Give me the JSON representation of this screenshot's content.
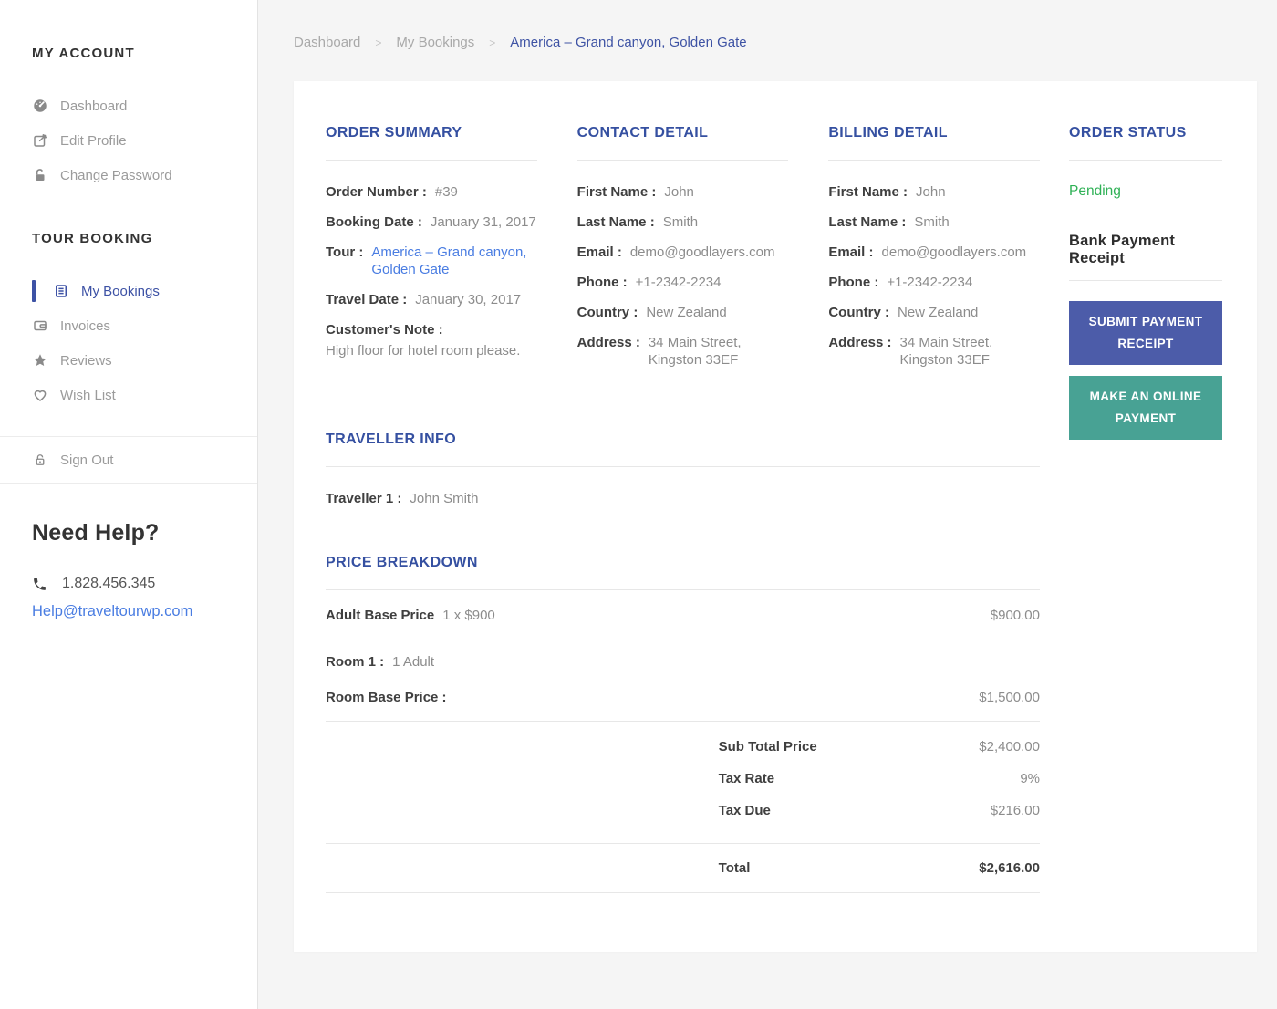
{
  "colors": {
    "accent_indigo": "#3550a1",
    "link_blue": "#4a7de2",
    "status_green": "#2fb156",
    "button_indigo": "#4c5ca9",
    "button_teal": "#48a294"
  },
  "breadcrumb": {
    "separator": ">",
    "items": [
      "Dashboard",
      "My Bookings",
      "America – Grand canyon, Golden Gate"
    ]
  },
  "sidebar": {
    "account": {
      "heading": "MY ACCOUNT",
      "items": [
        {
          "label": "Dashboard",
          "icon": "dashboard-icon"
        },
        {
          "label": "Edit Profile",
          "icon": "edit-icon"
        },
        {
          "label": "Change Password",
          "icon": "lock-icon"
        }
      ]
    },
    "booking": {
      "heading": "TOUR BOOKING",
      "items": [
        {
          "label": "My Bookings",
          "icon": "bookings-icon",
          "active": true
        },
        {
          "label": "Invoices",
          "icon": "wallet-icon"
        },
        {
          "label": "Reviews",
          "icon": "star-icon"
        },
        {
          "label": "Wish List",
          "icon": "heart-icon"
        }
      ]
    },
    "signout": {
      "label": "Sign Out",
      "icon": "unlock-icon"
    },
    "help": {
      "heading": "Need Help?",
      "phone": "1.828.456.345",
      "email": "Help@traveltourwp.com"
    }
  },
  "order_summary": {
    "title": "ORDER SUMMARY",
    "rows": [
      {
        "label": "Order Number :",
        "value": "#39"
      },
      {
        "label": "Booking Date :",
        "value": "January 31, 2017"
      },
      {
        "label": "Tour :",
        "value": "America – Grand canyon,\nGolden Gate"
      },
      {
        "label": "Travel Date :",
        "value": "January 30, 2017"
      }
    ],
    "note_label": "Customer's Note :",
    "note_text": "High floor for hotel room please."
  },
  "contact_detail": {
    "title": "CONTACT DETAIL",
    "rows": [
      {
        "label": "First Name :",
        "value": "John"
      },
      {
        "label": "Last Name :",
        "value": "Smith"
      },
      {
        "label": "Email :",
        "value": "demo@goodlayers.com"
      },
      {
        "label": "Phone :",
        "value": "+1-2342-2234"
      },
      {
        "label": "Country :",
        "value": "New Zealand"
      },
      {
        "label": "Address :",
        "value": "34 Main Street,\nKingston 33EF"
      }
    ]
  },
  "billing_detail": {
    "title": "BILLING DETAIL",
    "rows": [
      {
        "label": "First Name :",
        "value": "John"
      },
      {
        "label": "Last Name :",
        "value": "Smith"
      },
      {
        "label": "Email :",
        "value": "demo@goodlayers.com"
      },
      {
        "label": "Phone :",
        "value": "+1-2342-2234"
      },
      {
        "label": "Country :",
        "value": "New Zealand"
      },
      {
        "label": "Address :",
        "value": "34 Main Street,\nKingston 33EF"
      }
    ]
  },
  "order_status": {
    "title": "ORDER STATUS",
    "status": "Pending",
    "receipt_heading": "Bank Payment Receipt",
    "submit_button": "SUBMIT PAYMENT RECEIPT",
    "online_button": "MAKE AN ONLINE PAYMENT"
  },
  "traveller_info": {
    "title": "TRAVELLER INFO",
    "rows": [
      {
        "label": "Traveller 1 :",
        "value": "John Smith"
      }
    ]
  },
  "price_breakdown": {
    "title": "PRICE BREAKDOWN",
    "adult_row": {
      "label": "Adult Base Price",
      "detail": "1 x $900",
      "amount": "$900.00"
    },
    "room_row": {
      "label": "Room 1 :",
      "detail": "1 Adult"
    },
    "room_price_row": {
      "label": "Room Base Price :",
      "amount": "$1,500.00"
    },
    "summary_rows": [
      {
        "label": "Sub Total Price",
        "amount": "$2,400.00"
      },
      {
        "label": "Tax Rate",
        "amount": "9%"
      },
      {
        "label": "Tax Due",
        "amount": "$216.00"
      }
    ],
    "total_row": {
      "label": "Total",
      "amount": "$2,616.00"
    }
  }
}
